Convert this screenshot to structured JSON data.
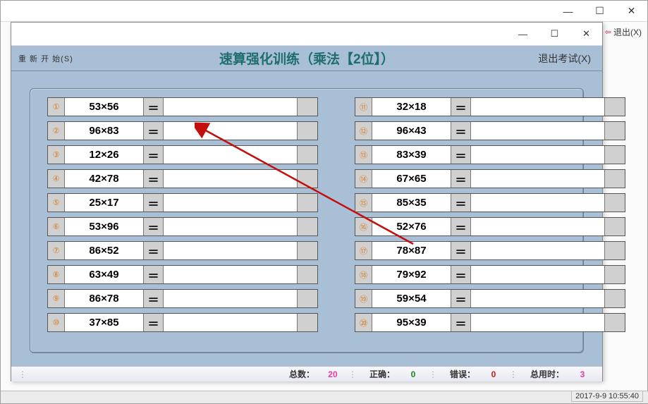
{
  "outer": {
    "exit_label": "退出(X)"
  },
  "header": {
    "left_label": "重 新 开 始(S)",
    "title": "速算强化训练（乘法【2位】）",
    "right_label": "退出考试(X)"
  },
  "problems_left": [
    {
      "n": "①",
      "expr": "53×56"
    },
    {
      "n": "②",
      "expr": "96×83"
    },
    {
      "n": "③",
      "expr": "12×26"
    },
    {
      "n": "④",
      "expr": "42×78"
    },
    {
      "n": "⑤",
      "expr": "25×17"
    },
    {
      "n": "⑥",
      "expr": "53×96"
    },
    {
      "n": "⑦",
      "expr": "86×52"
    },
    {
      "n": "⑧",
      "expr": "63×49"
    },
    {
      "n": "⑨",
      "expr": "86×78"
    },
    {
      "n": "⑩",
      "expr": "37×85"
    }
  ],
  "problems_right": [
    {
      "n": "⑪",
      "expr": "32×18"
    },
    {
      "n": "⑫",
      "expr": "96×43"
    },
    {
      "n": "⑬",
      "expr": "83×39"
    },
    {
      "n": "⑭",
      "expr": "67×65"
    },
    {
      "n": "⑮",
      "expr": "85×35"
    },
    {
      "n": "⑯",
      "expr": "52×76"
    },
    {
      "n": "⑰",
      "expr": "78×87"
    },
    {
      "n": "⑱",
      "expr": "79×92"
    },
    {
      "n": "⑲",
      "expr": "59×54"
    },
    {
      "n": "⑳",
      "expr": "95×39"
    }
  ],
  "eq": "＝",
  "status": {
    "total_label": "总数：",
    "total_val": "20",
    "correct_label": "正确：",
    "correct_val": "0",
    "wrong_label": "错误：",
    "wrong_val": "0",
    "time_label": "总用时：",
    "time_val": "3"
  },
  "clock": "2017-9-9 10:55:40"
}
